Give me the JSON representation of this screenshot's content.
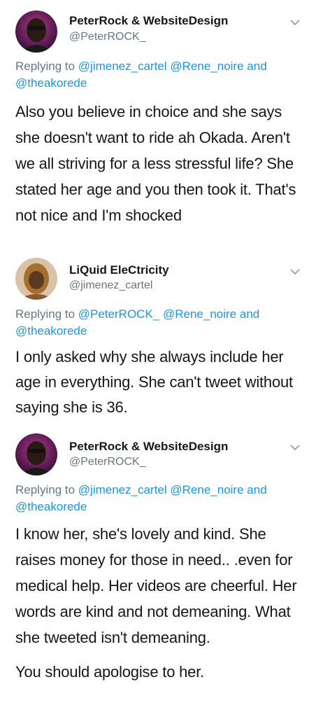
{
  "colors": {
    "text": "#14171a",
    "secondary": "#657786",
    "link": "#1b95e0"
  },
  "tweets": [
    {
      "author": "PeterRock & WebsiteDesign",
      "handle": "@PeterROCK_",
      "reply_prefix": "Replying to ",
      "reply_mentions": [
        "@jimenez_cartel",
        "@Rene_noire",
        "@theakorede"
      ],
      "reply_joiner": "and",
      "text": "Also you believe in choice and she says she doesn't want to ride ah Okada. Aren't we all striving for a less stressful life? She stated her age and you then took it. That's not nice and I'm shocked",
      "avatar_icon": "avatar-peterrock"
    },
    {
      "author": "LiQuid EleCtricity",
      "handle": "@jimenez_cartel",
      "reply_prefix": "Replying to ",
      "reply_mentions": [
        "@PeterROCK_",
        "@Rene_noire",
        "@theakorede"
      ],
      "reply_joiner": "and",
      "text": "I only asked why she always include her age in everything. She can't tweet without saying she is 36.",
      "avatar_icon": "avatar-liquid"
    },
    {
      "author": "PeterRock & WebsiteDesign",
      "handle": "@PeterROCK_",
      "reply_prefix": "Replying to ",
      "reply_mentions": [
        "@jimenez_cartel",
        "@Rene_noire",
        "@theakorede"
      ],
      "reply_joiner": "and",
      "text": "I know her, she's lovely and kind. She raises money for those in need.. .even for medical help. Her videos are cheerful. Her words are kind and not demeaning. What she tweeted isn't demeaning.",
      "text2": "You should apologise to her.",
      "avatar_icon": "avatar-peterrock"
    }
  ]
}
